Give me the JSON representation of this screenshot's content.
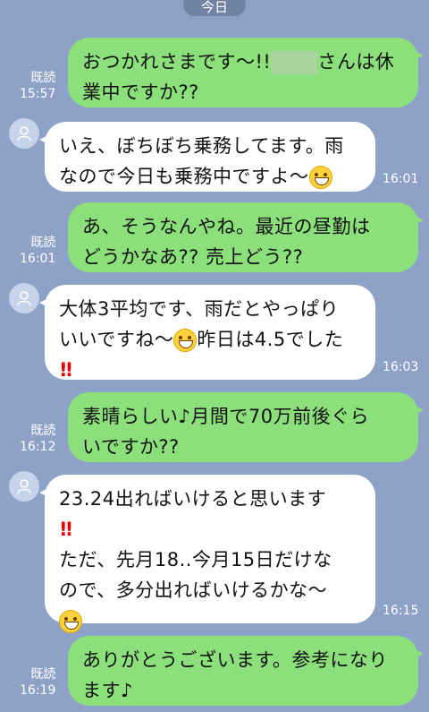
{
  "date_header": "今日",
  "messages": [
    {
      "l1": "おつかれさまです〜!!",
      "l2": "さんは休",
      "l3": "業中ですか??",
      "read": "既読",
      "time": "15:57"
    },
    {
      "l1": "いえ、ぼちぼち乗務してます。雨",
      "l2": "なので今日も乗務中ですよ〜",
      "time": "16:01"
    },
    {
      "l1": "あ、そうなんやね。最近の昼勤は",
      "l2": "どうかなあ?? 売上どう??",
      "read": "既読",
      "time": "16:01"
    },
    {
      "l1": "大体3平均です、雨だとやっぱり",
      "l2a": "いいですね〜",
      "l2b": "昨日は4.5でした",
      "bang": "!!",
      "time": "16:03"
    },
    {
      "l1": "素晴らしい♪月間で70万前後ぐら",
      "l2": "いですか??",
      "read": "既読",
      "time": "16:12"
    },
    {
      "l1": "23.24出ればいけると思います",
      "bang": "!!",
      "l3": "ただ、先月18..今月15日だけな",
      "l4": "ので、多分出ればいけるかな〜",
      "time": "16:15"
    },
    {
      "l1": "ありがとうございます。参考になり",
      "l2": "ます♪",
      "read": "既読",
      "time": "16:19"
    }
  ]
}
